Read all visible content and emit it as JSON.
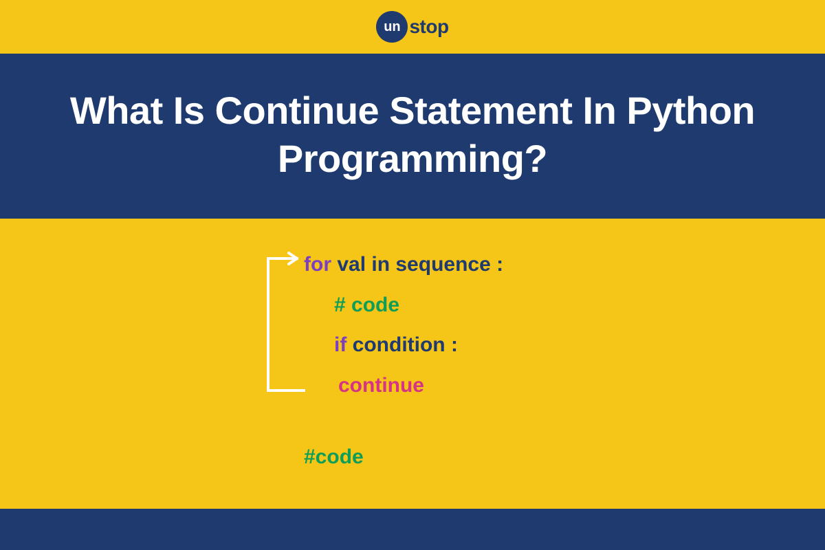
{
  "logo": {
    "circle_text": "un",
    "rest_text": "stop"
  },
  "title": "What Is Continue Statement In Python Programming?",
  "code": {
    "line1_kw": "for",
    "line1_txt": " val in sequence :",
    "line2": "# code",
    "line3_kw": "if",
    "line3_txt": " condition :",
    "line4": "continue",
    "line5": "#code"
  }
}
